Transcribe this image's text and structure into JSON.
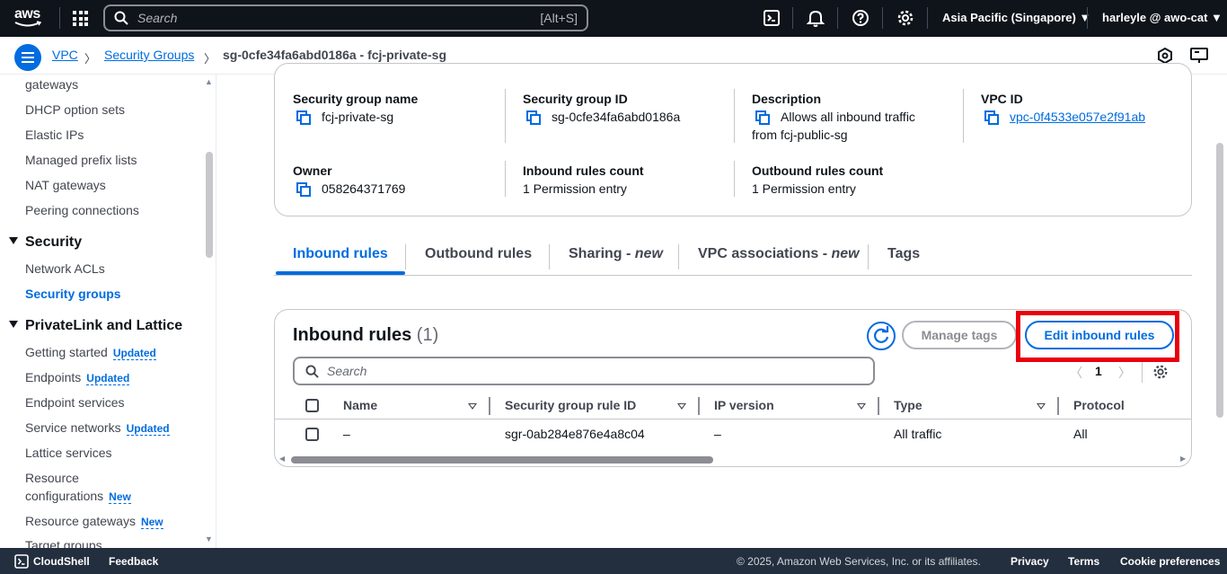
{
  "topnav": {
    "logo_text": "aws",
    "search_placeholder": "Search",
    "search_shortcut": "[Alt+S]",
    "region": "Asia Pacific (Singapore) ▼",
    "user": "harleyle @ awo-cat ▼"
  },
  "breadcrumb": {
    "items": [
      "VPC",
      "Security Groups",
      "sg-0cfe34fa6abd0186a - fcj-private-sg"
    ]
  },
  "sidebar": {
    "items_top": [
      "gateways",
      "DHCP option sets",
      "Elastic IPs",
      "Managed prefix lists",
      "NAT gateways",
      "Peering connections"
    ],
    "section_security": "Security",
    "security_items": [
      "Network ACLs",
      "Security groups"
    ],
    "section_privatelink": "PrivateLink and Lattice",
    "privatelink_items": [
      {
        "label": "Getting started",
        "badge": "Updated"
      },
      {
        "label": "Endpoints",
        "badge": "Updated"
      },
      {
        "label": "Endpoint services",
        "badge": ""
      },
      {
        "label": "Service networks",
        "badge": "Updated"
      },
      {
        "label": "Lattice services",
        "badge": ""
      },
      {
        "label": "Resource",
        "badge": ""
      },
      {
        "label": "configurations",
        "badge": "New"
      },
      {
        "label": "Resource gateways",
        "badge": "New"
      },
      {
        "label": "Target groups",
        "badge": ""
      }
    ]
  },
  "details": {
    "sg_name_label": "Security group name",
    "sg_name": "fcj-private-sg",
    "sg_id_label": "Security group ID",
    "sg_id": "sg-0cfe34fa6abd0186a",
    "description_label": "Description",
    "description_line1": "Allows all inbound traffic",
    "description_line2": "from fcj-public-sg",
    "vpc_id_label": "VPC ID",
    "vpc_id": "vpc-0f4533e057e2f91ab",
    "owner_label": "Owner",
    "owner": "058264371769",
    "inbound_count_label": "Inbound rules count",
    "inbound_count": "1 Permission entry",
    "outbound_count_label": "Outbound rules count",
    "outbound_count": "1 Permission entry"
  },
  "tabs": {
    "inbound": "Inbound rules",
    "outbound": "Outbound rules",
    "sharing": "Sharing - ",
    "sharing_new": "new",
    "vpc_assoc": "VPC associations - ",
    "vpc_assoc_new": "new",
    "tags": "Tags"
  },
  "rules": {
    "title": "Inbound rules",
    "count": "(1)",
    "manage_tags": "Manage tags",
    "edit_inbound": "Edit inbound rules",
    "search_placeholder": "Search",
    "page": "1",
    "columns": [
      "Name",
      "Security group rule ID",
      "IP version",
      "Type",
      "Protocol"
    ],
    "rows": [
      {
        "name": "–",
        "rule_id": "sgr-0ab284e876e4a8c04",
        "ip_version": "–",
        "type": "All traffic",
        "protocol": "All"
      }
    ]
  },
  "footer": {
    "cloudshell": "CloudShell",
    "feedback": "Feedback",
    "copyright": "© 2025, Amazon Web Services, Inc. or its affiliates.",
    "privacy": "Privacy",
    "terms": "Terms",
    "cookies": "Cookie preferences"
  }
}
